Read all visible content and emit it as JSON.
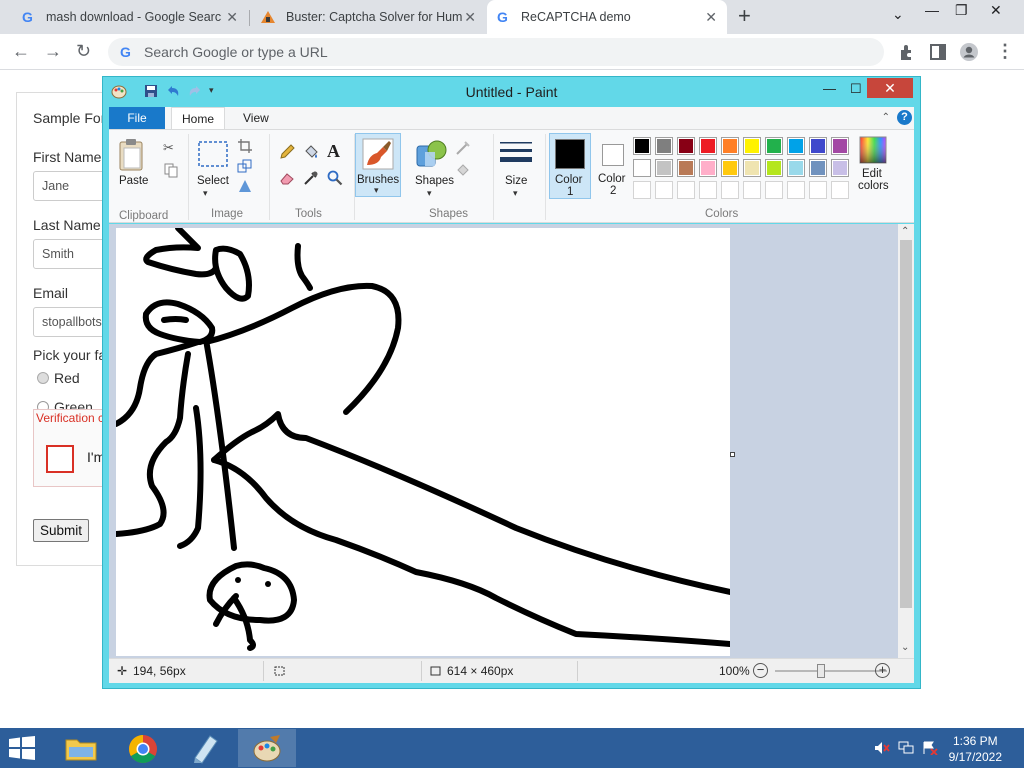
{
  "browser": {
    "tabs": [
      {
        "title": "mash download - Google Search",
        "favicon": "google-g-icon",
        "active": false
      },
      {
        "title": "Buster: Captcha Solver for Human",
        "favicon": "buster-extension-icon",
        "active": false
      },
      {
        "title": "ReCAPTCHA demo",
        "favicon": "google-g-icon",
        "active": true
      }
    ],
    "new_tab": "+",
    "address_placeholder": "Search Google or type a URL"
  },
  "form": {
    "title": "Sample For",
    "first_name_label": "First Name",
    "first_name_value": "Jane",
    "last_name_label": "Last Name",
    "last_name_value": "Smith",
    "email_label": "Email",
    "email_value": "stopallbots",
    "color_label": "Pick your fa",
    "color_options": [
      "Red",
      "Green"
    ],
    "error_text": "Verification c checkbox ag",
    "checkbox_label": "I'm",
    "submit_label": "Submit"
  },
  "paint": {
    "title": "Untitled - Paint",
    "tabs": {
      "file": "File",
      "home": "Home",
      "view": "View"
    },
    "groups": {
      "clipboard": "Clipboard",
      "image": "Image",
      "tools": "Tools",
      "shapes": "Shapes",
      "colors": "Colors"
    },
    "buttons": {
      "paste": "Paste",
      "select": "Select",
      "brushes": "Brushes",
      "shapes": "Shapes",
      "size": "Size",
      "color1_a": "Color",
      "color1_b": "1",
      "color2_a": "Color",
      "color2_b": "2",
      "edit_a": "Edit",
      "edit_b": "colors"
    },
    "palette_row1": [
      "#000000",
      "#7f7f7f",
      "#880015",
      "#ed1c24",
      "#ff7f27",
      "#fff200",
      "#22b14c",
      "#00a2e8",
      "#3f48cc",
      "#a349a4"
    ],
    "palette_row2": [
      "#ffffff",
      "#c3c3c3",
      "#b97a57",
      "#ffaec9",
      "#ffc90e",
      "#efe4b0",
      "#b5e61d",
      "#99d9ea",
      "#7092be",
      "#c8bfe7"
    ],
    "color1": "#000000",
    "color2": "#ffffff",
    "status": {
      "cursor": "194, 56px",
      "size": "614 × 460px",
      "zoom": "100%"
    }
  },
  "taskbar": {
    "time": "1:36 PM",
    "date": "9/17/2022"
  }
}
